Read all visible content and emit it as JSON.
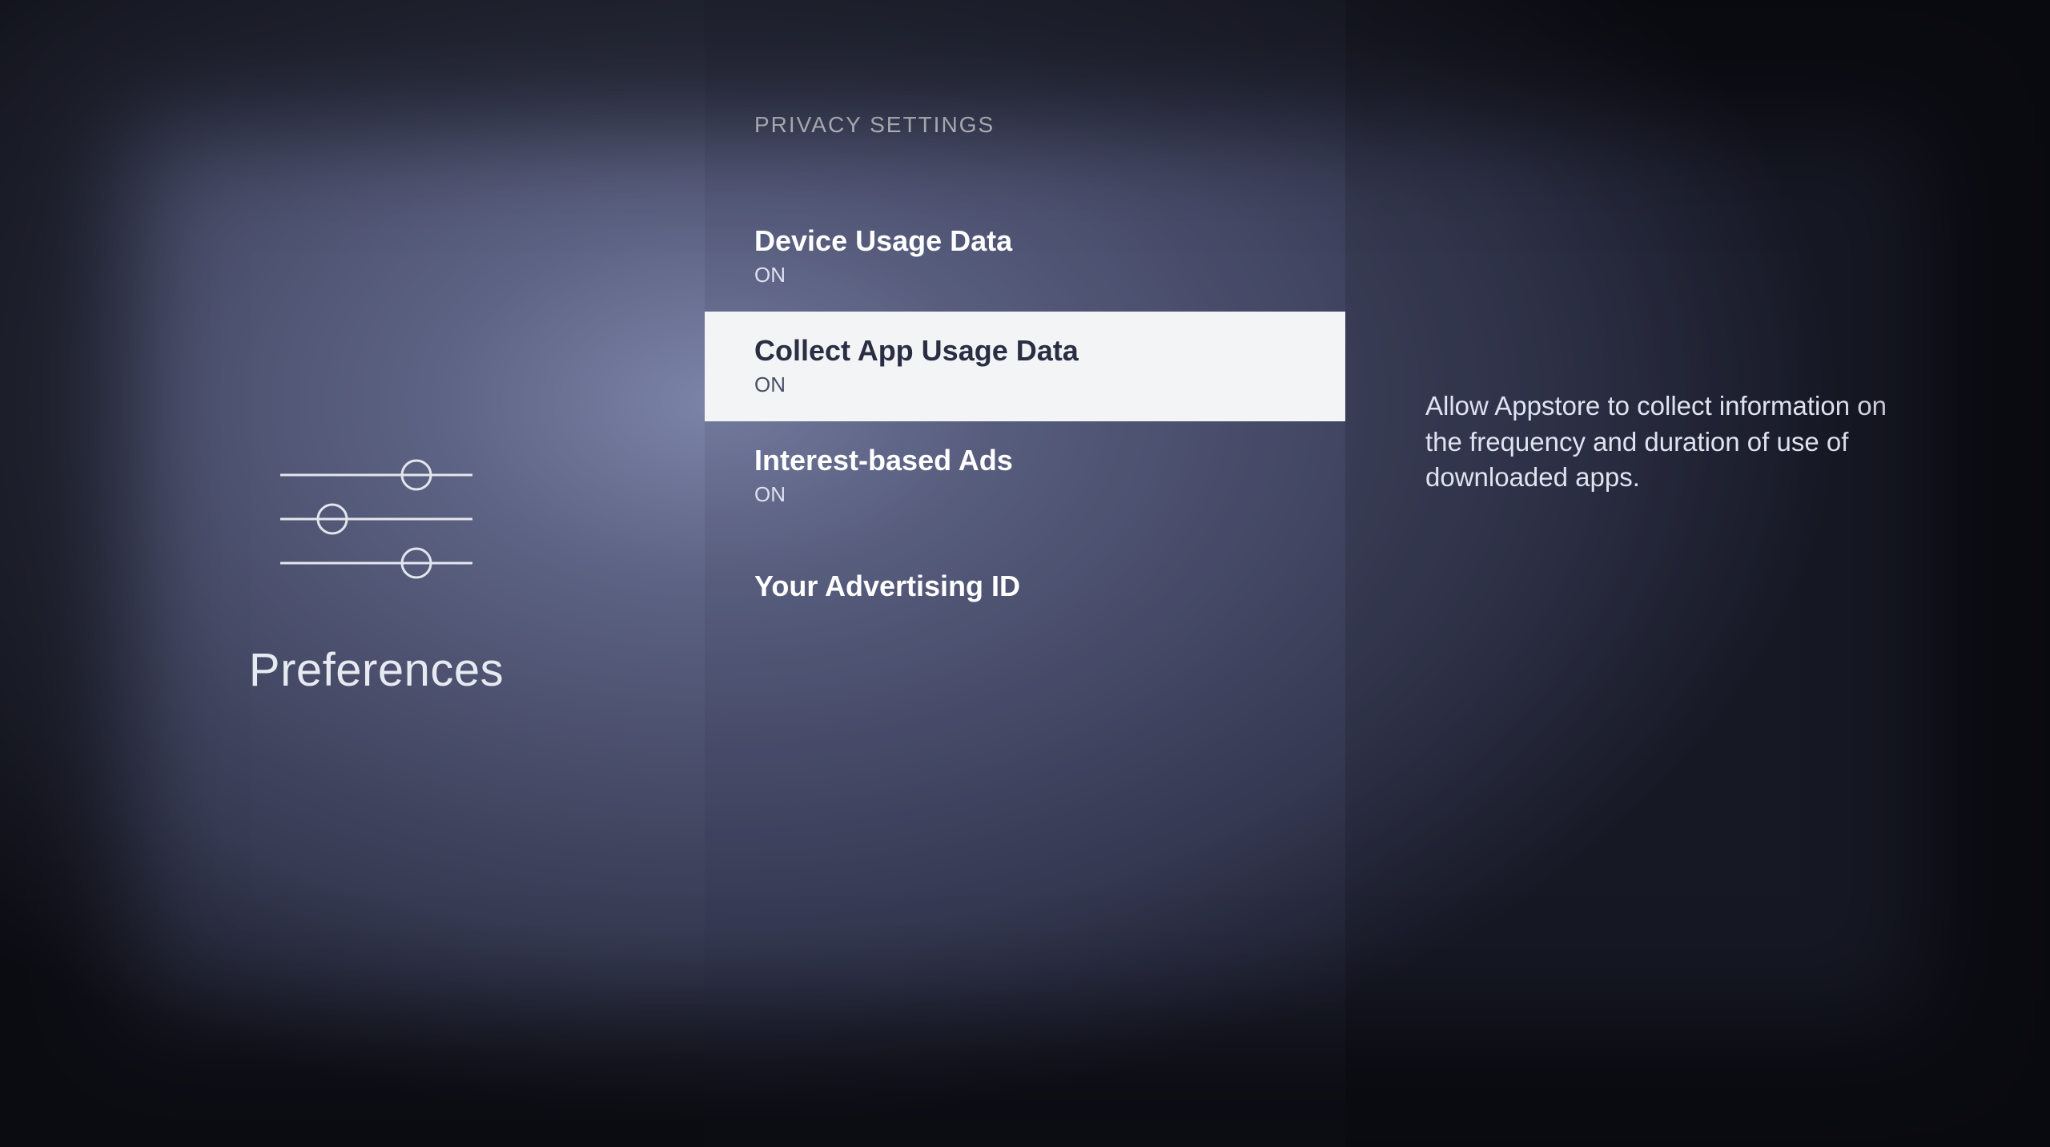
{
  "left": {
    "title": "Preferences",
    "icon": "sliders-icon"
  },
  "header": "PRIVACY SETTINGS",
  "items": [
    {
      "title": "Device Usage Data",
      "status": "ON",
      "selected": false
    },
    {
      "title": "Collect App Usage Data",
      "status": "ON",
      "selected": true
    },
    {
      "title": "Interest-based Ads",
      "status": "ON",
      "selected": false
    },
    {
      "title": "Your Advertising ID",
      "status": null,
      "selected": false
    }
  ],
  "description": "Allow Appstore to collect information on the frequency and duration of use of downloaded apps."
}
